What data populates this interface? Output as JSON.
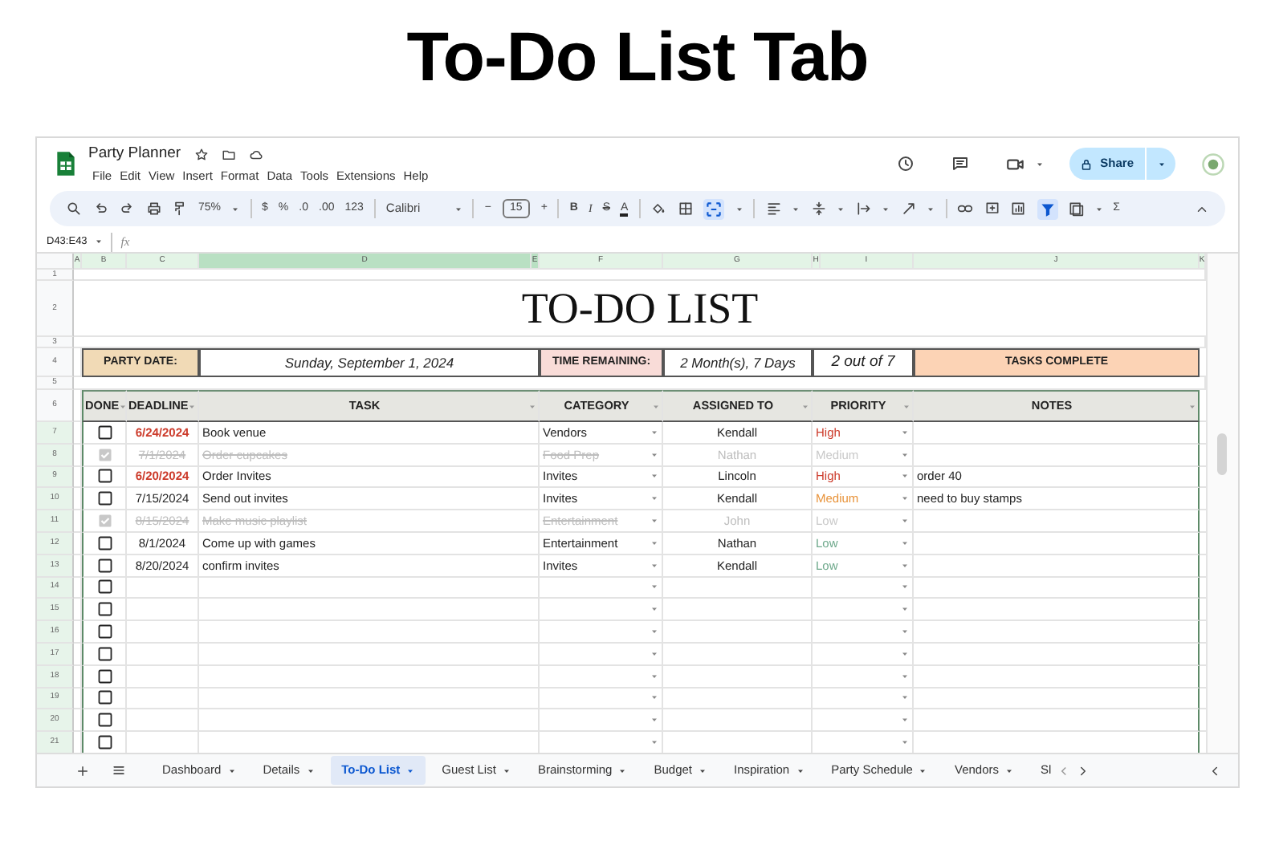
{
  "page_title": "To-Do List Tab",
  "app": {
    "doc_title": "Party Planner",
    "menus": [
      "File",
      "Edit",
      "View",
      "Insert",
      "Format",
      "Data",
      "Tools",
      "Extensions",
      "Help"
    ],
    "share": "Share"
  },
  "toolbar": {
    "zoom": "75%",
    "currency": "$",
    "percent": "%",
    "decrease_decimal": ".0",
    "increase_decimal": ".00",
    "number_format": "123",
    "font": "Calibri",
    "size_minus": "−",
    "font_size": "15",
    "size_plus": "+",
    "bold": "B",
    "italic": "I",
    "strikethrough": "S",
    "text_color": "A",
    "functions": "Σ"
  },
  "name_box": "D43:E43",
  "formula_label": "fx",
  "columns": [
    {
      "letter": "A",
      "selected": false
    },
    {
      "letter": "B",
      "selected": false
    },
    {
      "letter": "C",
      "selected": false
    },
    {
      "letter": "D",
      "selected": true
    },
    {
      "letter": "E",
      "selected": true
    },
    {
      "letter": "F",
      "selected": false
    },
    {
      "letter": "G",
      "selected": false
    },
    {
      "letter": "H",
      "selected": false
    },
    {
      "letter": "I",
      "selected": false
    },
    {
      "letter": "J",
      "selected": false
    },
    {
      "letter": "K",
      "selected": false
    }
  ],
  "top_rows": [
    "1",
    "2",
    "3",
    "4",
    "5",
    "6"
  ],
  "sheet_title": "TO-DO LIST",
  "summary": {
    "party_date_label": "PARTY DATE:",
    "party_date": "Sunday, September 1, 2024",
    "time_remaining_label": "TIME REMAINING:",
    "time_remaining": "2 Month(s), 7 Days",
    "progress": "2 out of 7",
    "progress_label": "TASKS COMPLETE"
  },
  "headers": [
    "DONE",
    "DEADLINE",
    "TASK",
    "CATEGORY",
    "ASSIGNED TO",
    "PRIORITY",
    "NOTES"
  ],
  "rows": [
    {
      "row": "7",
      "done": false,
      "deadline": "6/24/2024",
      "overdue": true,
      "task": "Book venue",
      "category": "Vendors",
      "assigned": "Kendall",
      "priority": {
        "label": "High",
        "color": "#cc3b2b"
      }
    },
    {
      "row": "8",
      "done": true,
      "deadline": "7/1/2024",
      "overdue": false,
      "task": "Order cupcakes",
      "category": "Food Prep",
      "assigned": "Nathan",
      "priority": {
        "label": "Medium",
        "color": "#c9c9c9"
      }
    },
    {
      "row": "9",
      "done": false,
      "deadline": "6/20/2024",
      "overdue": true,
      "task": "Order Invites",
      "category": "Invites",
      "assigned": "Lincoln",
      "priority": {
        "label": "High",
        "color": "#cc3b2b"
      },
      "notes": "order 40"
    },
    {
      "row": "10",
      "done": false,
      "deadline": "7/15/2024",
      "overdue": false,
      "task": "Send out invites",
      "category": "Invites",
      "assigned": "Kendall",
      "priority": {
        "label": "Medium",
        "color": "#e8933a"
      },
      "notes": "need to buy stamps"
    },
    {
      "row": "11",
      "done": true,
      "deadline": "8/15/2024",
      "overdue": false,
      "task": "Make music playlist",
      "category": "Entertainment",
      "assigned": "John",
      "priority": {
        "label": "Low",
        "color": "#c9c9c9"
      }
    },
    {
      "row": "12",
      "done": false,
      "deadline": "8/1/2024",
      "overdue": false,
      "task": "Come up with games",
      "category": "Entertainment",
      "assigned": "Nathan",
      "priority": {
        "label": "Low",
        "color": "#6fa98c"
      }
    },
    {
      "row": "13",
      "done": false,
      "deadline": "8/20/2024",
      "overdue": false,
      "task": "confirm invites",
      "category": "Invites",
      "assigned": "Kendall",
      "priority": {
        "label": "Low",
        "color": "#6fa98c"
      }
    },
    {
      "row": "14",
      "done": false
    },
    {
      "row": "15",
      "done": false
    },
    {
      "row": "16",
      "done": false
    },
    {
      "row": "17",
      "done": false
    },
    {
      "row": "18",
      "done": false
    },
    {
      "row": "19",
      "done": false
    },
    {
      "row": "20",
      "done": false
    },
    {
      "row": "21",
      "done": false
    }
  ],
  "sheet_tabs": [
    {
      "label": "Dashboard",
      "selected": false,
      "truncated": false
    },
    {
      "label": "Details",
      "selected": false,
      "truncated": false
    },
    {
      "label": "To-Do List",
      "selected": true,
      "truncated": false
    },
    {
      "label": "Guest List",
      "selected": false,
      "truncated": false
    },
    {
      "label": "Brainstorming",
      "selected": false,
      "truncated": false
    },
    {
      "label": "Budget",
      "selected": false,
      "truncated": false
    },
    {
      "label": "Inspiration",
      "selected": false,
      "truncated": false
    },
    {
      "label": "Party Schedule",
      "selected": false,
      "truncated": false
    },
    {
      "label": "Vendors",
      "selected": false,
      "truncated": false
    },
    {
      "label": "Sl",
      "selected": false,
      "truncated": true
    }
  ]
}
